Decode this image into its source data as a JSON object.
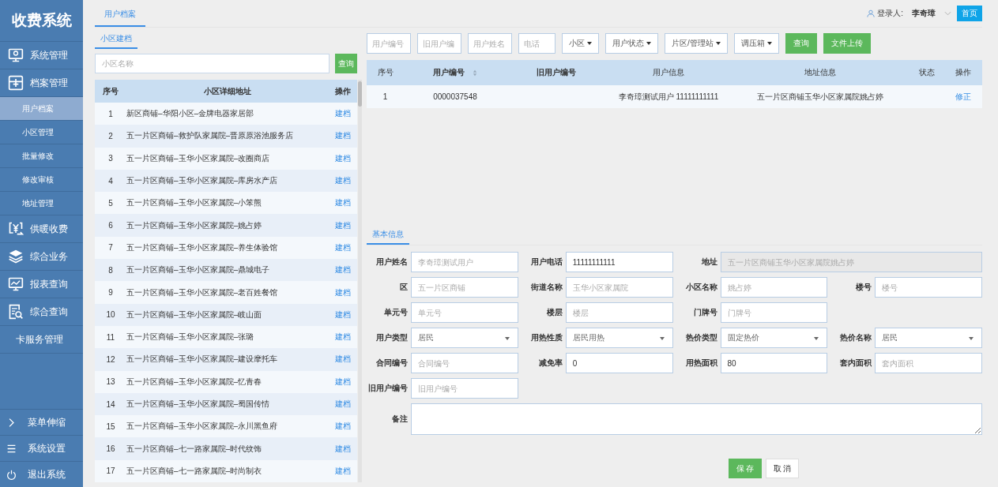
{
  "sidebar": {
    "title": "收费系统",
    "items": [
      {
        "label": "系统管理",
        "kind": "main",
        "selected": false
      },
      {
        "label": "档案管理",
        "kind": "main",
        "selected": false
      },
      {
        "label": "用户档案",
        "kind": "sub",
        "selected": true
      },
      {
        "label": "小区管理",
        "kind": "sub",
        "selected": false
      },
      {
        "label": "批量修改",
        "kind": "sub",
        "selected": false
      },
      {
        "label": "修改审核",
        "kind": "sub",
        "selected": false
      },
      {
        "label": "地址管理",
        "kind": "sub",
        "selected": false
      },
      {
        "label": "供暖收费",
        "kind": "main",
        "selected": false
      },
      {
        "label": "综合业务",
        "kind": "main",
        "selected": false
      },
      {
        "label": "报表查询",
        "kind": "main",
        "selected": false
      },
      {
        "label": "综合查询",
        "kind": "main",
        "selected": false
      },
      {
        "label": "卡服务管理",
        "kind": "plain",
        "selected": false
      }
    ],
    "bottom_items": [
      {
        "label": "菜单伸缩"
      },
      {
        "label": "系统设置"
      },
      {
        "label": "退出系统"
      }
    ]
  },
  "tabs": [
    {
      "label": "用户档案",
      "selected": true
    }
  ],
  "user": {
    "prefix": "登录人:",
    "name": "李奇璋",
    "home_button": "首页"
  },
  "left_panel": {
    "tabs": [
      {
        "label": "小区建档",
        "selected": true
      }
    ],
    "search": {
      "placeholder": "小区名称",
      "button": "查询"
    },
    "table": {
      "columns": [
        "序号",
        "小区详细地址",
        "操作"
      ],
      "rows": [
        {
          "index": "1",
          "address": "新区商铺–华阳小区–金牌电器家居部",
          "action": "建档"
        },
        {
          "index": "2",
          "address": "五一片区商铺–救护队家属院–晋原原浴池服务店",
          "action": "建档"
        },
        {
          "index": "3",
          "address": "五一片区商铺–玉华小区家属院–改圈商店",
          "action": "建档"
        },
        {
          "index": "4",
          "address": "五一片区商铺–玉华小区家属院–库房水产店",
          "action": "建档"
        },
        {
          "index": "5",
          "address": "五一片区商铺–玉华小区家属院–小笨熊",
          "action": "建档"
        },
        {
          "index": "6",
          "address": "五一片区商铺–玉华小区家属院–姚占婷",
          "action": "建档"
        },
        {
          "index": "7",
          "address": "五一片区商铺–玉华小区家属院–养生体验馆",
          "action": "建档"
        },
        {
          "index": "8",
          "address": "五一片区商铺–玉华小区家属院–鼎城电子",
          "action": "建档"
        },
        {
          "index": "9",
          "address": "五一片区商铺–玉华小区家属院–老百姓餐馆",
          "action": "建档"
        },
        {
          "index": "10",
          "address": "五一片区商铺–玉华小区家属院–岐山面",
          "action": "建档"
        },
        {
          "index": "11",
          "address": "五一片区商铺–玉华小区家属院–张璐",
          "action": "建档"
        },
        {
          "index": "12",
          "address": "五一片区商铺–玉华小区家属院–建设摩托车",
          "action": "建档"
        },
        {
          "index": "13",
          "address": "五一片区商铺–玉华小区家属院–忆青春",
          "action": "建档"
        },
        {
          "index": "14",
          "address": "五一片区商铺–玉华小区家属院–蜀国传情",
          "action": "建档"
        },
        {
          "index": "15",
          "address": "五一片区商铺–玉华小区家属院–永川黑鱼府",
          "action": "建档"
        },
        {
          "index": "16",
          "address": "五一片区商铺–七一路家属院–时代纹饰",
          "action": "建档"
        },
        {
          "index": "17",
          "address": "五一片区商铺–七一路家属院–时尚制衣",
          "action": "建档"
        }
      ]
    }
  },
  "filters": [
    {
      "kind": "input",
      "placeholder": "用户编号"
    },
    {
      "kind": "input",
      "placeholder": "旧用户编"
    },
    {
      "kind": "input",
      "placeholder": "用户姓名"
    },
    {
      "kind": "input",
      "placeholder": "电话"
    },
    {
      "kind": "dropdown",
      "label": "小区"
    },
    {
      "kind": "dropdown",
      "label": "用户状态"
    },
    {
      "kind": "dropdown",
      "label": "片区/管理站"
    },
    {
      "kind": "dropdown",
      "label": "调压箱"
    },
    {
      "kind": "button",
      "label": "查询"
    },
    {
      "kind": "button",
      "label": "文件上传"
    }
  ],
  "user_table": {
    "columns": [
      "序号",
      "用户编号",
      "旧用户编号",
      "用户信息",
      "地址信息",
      "状态",
      "操作"
    ],
    "rows": [
      {
        "index": "1",
        "user_no": "0000037548",
        "user_info": "李奇璋测试用户  11111111111",
        "address": "五一片区商铺玉华小区家属院姚占婷",
        "action": "修正"
      }
    ]
  },
  "form": {
    "tabs": [
      {
        "label": "基本信息",
        "selected": true
      }
    ],
    "rows": [
      [
        {
          "label": "用户姓名",
          "kind": "text",
          "placeholder": "李奇璋测试用户",
          "disabled": false
        },
        {
          "label": "用户电话",
          "kind": "text",
          "value": "11111111111",
          "disabled": false
        },
        {
          "label": "地址",
          "kind": "long",
          "placeholder": "五一片区商铺玉华小区家属院姚占婷",
          "disabled": true
        }
      ],
      [
        {
          "label": "区",
          "kind": "text",
          "placeholder": "五一片区商铺",
          "disabled": false
        },
        {
          "label": "街道名称",
          "kind": "text",
          "placeholder": "玉华小区家属院",
          "disabled": false
        },
        {
          "label": "小区名称",
          "kind": "text",
          "placeholder": "姚占婷",
          "disabled": false
        },
        {
          "label": "楼号",
          "kind": "text",
          "placeholder": "楼号",
          "disabled": false
        }
      ],
      [
        {
          "label": "单元号",
          "kind": "text",
          "placeholder": "单元号",
          "disabled": false
        },
        {
          "label": "楼层",
          "kind": "text",
          "placeholder": "楼层",
          "disabled": false
        },
        {
          "label": "门牌号",
          "kind": "text",
          "placeholder": "门牌号",
          "disabled": false
        }
      ],
      [
        {
          "label": "用户类型",
          "kind": "select",
          "value": "居民",
          "disabled": false
        },
        {
          "label": "用热性质",
          "kind": "select",
          "value": "居民用热",
          "disabled": false
        },
        {
          "label": "热价类型",
          "kind": "select",
          "value": "固定热价",
          "disabled": false
        },
        {
          "label": "热价名称",
          "kind": "select",
          "value": "居民",
          "disabled": false
        }
      ],
      [
        {
          "label": "合同编号",
          "kind": "text",
          "placeholder": "合同编号",
          "disabled": false
        },
        {
          "label": "减免率",
          "kind": "text",
          "value": "0",
          "disabled": false
        },
        {
          "label": "用热面积",
          "kind": "text",
          "value": "80",
          "disabled": false
        },
        {
          "label": "套内面积",
          "kind": "text",
          "placeholder": "套内面积",
          "disabled": false
        }
      ],
      [
        {
          "label": "旧用户编号",
          "kind": "text",
          "placeholder": "旧用户编号",
          "disabled": false
        }
      ],
      [
        {
          "label": "备注",
          "kind": "memo",
          "disabled": false
        }
      ]
    ],
    "buttons": [
      {
        "label": "保 存",
        "kind": "primary"
      },
      {
        "label": "取 消",
        "kind": "default"
      }
    ]
  }
}
